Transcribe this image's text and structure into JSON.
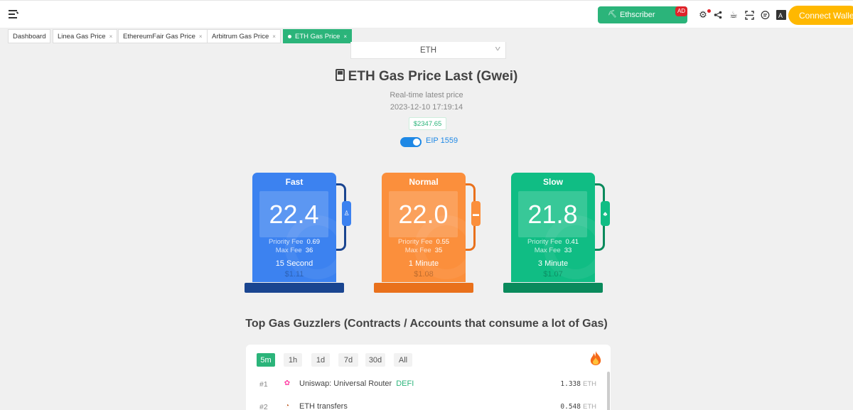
{
  "topbar": {
    "ethscriber_label": "Ethscriber",
    "ad_badge": "AD",
    "connect_wallet": "Connect Wallet"
  },
  "tabs": [
    {
      "label": "Dashboard",
      "closable": false,
      "active": false
    },
    {
      "label": "Linea Gas Price",
      "closable": true,
      "active": false
    },
    {
      "label": "EthereumFair Gas Price",
      "closable": true,
      "active": false
    },
    {
      "label": "Arbitrum Gas Price",
      "closable": true,
      "active": false
    },
    {
      "label": "ETH Gas Price",
      "closable": true,
      "active": true
    }
  ],
  "tab_close": "×",
  "chain_select": {
    "value": "ETH"
  },
  "header": {
    "title": "ETH Gas Price Last (Gwei)",
    "subtitle": "Real-time latest price",
    "timestamp": "2023-12-10 17:19:14",
    "eth_price": "$2347.65",
    "eip_label": "EIP 1559",
    "eip_enabled": true
  },
  "fee_labels": {
    "priority": "Priority Fee",
    "max": "Max Fee"
  },
  "pumps": [
    {
      "name": "Fast",
      "gwei": "22.4",
      "priority_fee": "0.69",
      "max_fee": "36",
      "time": "15 Second",
      "cost": "$1.11",
      "color": "#3c82f0",
      "dark": "#1a4590",
      "icon": "rocket-icon"
    },
    {
      "name": "Normal",
      "gwei": "22.0",
      "priority_fee": "0.55",
      "max_fee": "35",
      "time": "1 Minute",
      "cost": "$1.08",
      "color": "#fb8f3c",
      "dark": "#e9711c",
      "icon": "car-icon"
    },
    {
      "name": "Slow",
      "gwei": "21.8",
      "priority_fee": "0.41",
      "max_fee": "33",
      "time": "3 Minute",
      "cost": "$1.07",
      "color": "#10bd84",
      "dark": "#0a8a5c",
      "icon": "tree-icon"
    }
  ],
  "guzzlers": {
    "title": "Top Gas Guzzlers (Contracts / Accounts that consume a lot of Gas)",
    "periods": [
      "5m",
      "1h",
      "1d",
      "7d",
      "30d",
      "All"
    ],
    "active_period": "5m",
    "rows": [
      {
        "rank": "#1",
        "name": "Uniswap: Universal Router",
        "tag": "DEFI",
        "amount": "1.338",
        "unit": "ETH",
        "icon": "uniswap-icon"
      },
      {
        "rank": "#2",
        "name": "ETH transfers",
        "tag": "",
        "amount": "0.548",
        "unit": "ETH",
        "icon": "transfer-icon"
      }
    ]
  }
}
